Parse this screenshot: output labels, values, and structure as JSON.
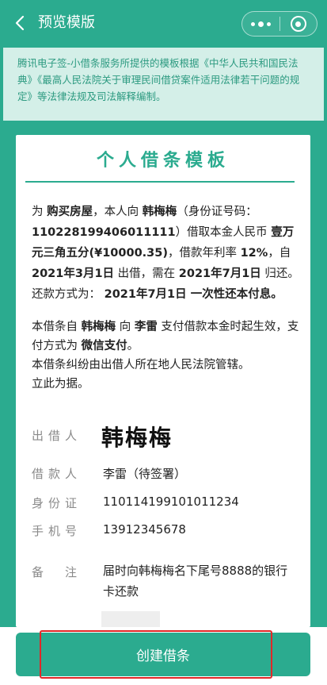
{
  "header": {
    "title": "预览模版"
  },
  "notice": {
    "text": "腾讯电子签-小借条服务所提供的模板根据《中华人民共和国民法典》《最高人民法院关于审理民间借贷案件适用法律若干问题的规定》等法律法规及司法解释编制。"
  },
  "document": {
    "title": "个人借条模板",
    "p1": {
      "t1": "为 ",
      "purpose": "购买房屋",
      "t2": "，本人向 ",
      "lender": "韩梅梅",
      "t3": "（身份证号码：",
      "id_number": "110228199406011111",
      "t4": "）借取本金人民币 ",
      "amount_words": "壹万元三角五分",
      "amount_digits": "(¥10000.35)",
      "t5": "，借款年利率 ",
      "rate": "12%",
      "t6": "，自 ",
      "start_date": "2021年3月1日",
      "t7": " 出借，需在 ",
      "due_date": "2021年7月1日",
      "t8": " 归还。还款方式为： ",
      "repay_method": "2021年7月1日 一次性还本付息。"
    },
    "p2": {
      "t1": "本借条自 ",
      "lender": "韩梅梅",
      "t2": " 向 ",
      "borrower": "李雷",
      "t3": " 支付借款本金时起生效，支付方式为 ",
      "pay_method": "微信支付",
      "t4": "。",
      "line2": "本借条纠纷由出借人所在地人民法院管辖。",
      "line3": "立此为据。"
    },
    "fields": {
      "lender_label": "出借人",
      "lender_signature": "韩梅梅",
      "borrower_label": "借款人",
      "borrower_value": "李雷（待签署）",
      "id_label": "身份证",
      "id_value": "110114199101011234",
      "phone_label": "手机号",
      "phone_value": "13912345678",
      "remark_label": "备　注",
      "remark_value": "届时向韩梅梅名下尾号8888的银行卡还款"
    }
  },
  "actions": {
    "create_label": "创建借条"
  },
  "colors": {
    "brand": "#2bab8f",
    "notice_bg": "#d4efe8",
    "highlight": "#e02828"
  }
}
